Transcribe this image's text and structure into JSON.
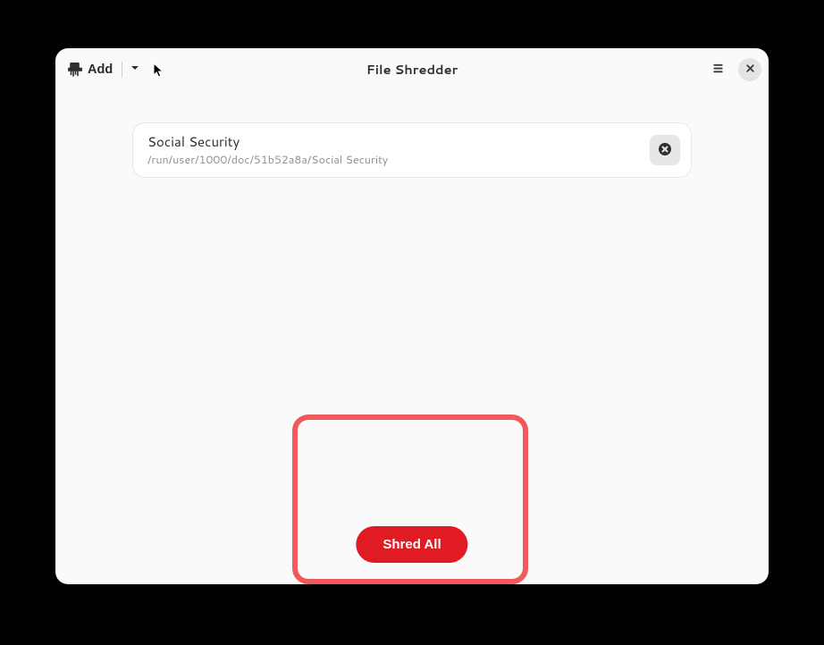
{
  "header": {
    "add_label": "Add",
    "title": "File Shredder"
  },
  "files": [
    {
      "name": "Social Security",
      "path": "/run/user/1000/doc/51b52a8a/Social Security"
    }
  ],
  "actions": {
    "shred_all": "Shred All"
  }
}
